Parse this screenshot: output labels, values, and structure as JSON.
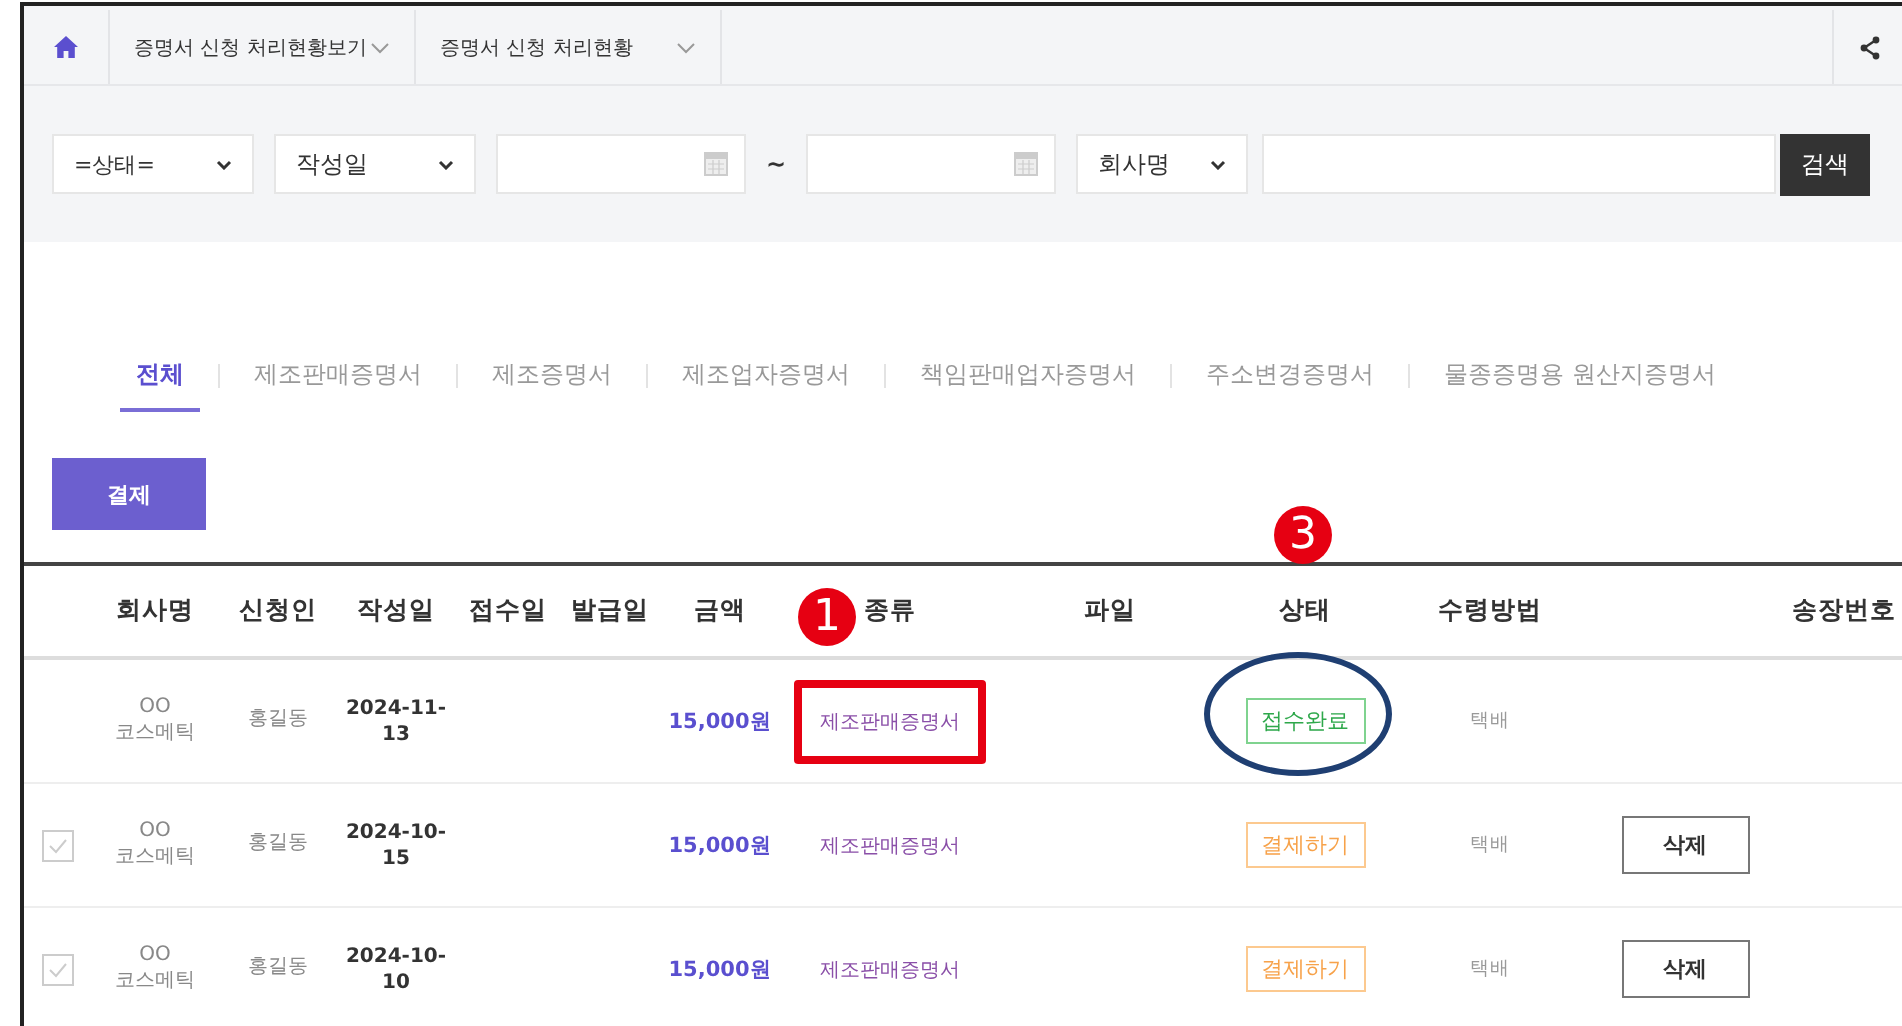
{
  "breadcrumbs": [
    {
      "label": "증명서 신청 처리현황보기"
    },
    {
      "label": "증명서 신청 처리현황"
    }
  ],
  "filters": {
    "status_select": "=상태=",
    "date_select": "작성일",
    "range_sep": "~",
    "field_select": "회사명",
    "search_button": "검색"
  },
  "tabs": [
    {
      "label": "전체",
      "selected": true
    },
    {
      "label": "제조판매증명서",
      "selected": false
    },
    {
      "label": "제조증명서",
      "selected": false
    },
    {
      "label": "제조업자증명서",
      "selected": false
    },
    {
      "label": "책임판매업자증명서",
      "selected": false
    },
    {
      "label": "주소변경증명서",
      "selected": false
    },
    {
      "label": "물종증명용 원산지증명서",
      "selected": false
    }
  ],
  "pay_button": "결제",
  "table": {
    "columns": [
      {},
      {
        "label": "회사명"
      },
      {
        "label": "신청인"
      },
      {
        "label": "작성일"
      },
      {
        "label": "접수일"
      },
      {
        "label": "발급일"
      },
      {
        "label": "금액"
      },
      {
        "label": "종류",
        "marker": "1"
      },
      {
        "label": "파일"
      },
      {
        "label": "상태",
        "marker": "3"
      },
      {
        "label": "수령방법"
      },
      {},
      {
        "label": "송장번호"
      }
    ],
    "rows": [
      {
        "company": [
          "OO",
          "코스메틱"
        ],
        "applicant": "홍길동",
        "written": [
          "2024-11-",
          "13"
        ],
        "amount": "15,000원",
        "type": "제조판매증명서",
        "type_boxed": true,
        "status": {
          "kind": "done",
          "label": "접수완료"
        },
        "status_circled": true,
        "delivery": "택배"
      },
      {
        "checked": false,
        "company": [
          "OO",
          "코스메틱"
        ],
        "applicant": "홍길동",
        "written": [
          "2024-10-",
          "15"
        ],
        "amount": "15,000원",
        "type": "제조판매증명서",
        "type_boxed": false,
        "status": {
          "kind": "pay",
          "label": "결제하기"
        },
        "status_circled": false,
        "delivery": "택배",
        "delete": "삭제"
      },
      {
        "checked": false,
        "company": [
          "OO",
          "코스메틱"
        ],
        "applicant": "홍길동",
        "written": [
          "2024-10-",
          "10"
        ],
        "amount": "15,000원",
        "type": "제조판매증명서",
        "type_boxed": false,
        "status": {
          "kind": "pay",
          "label": "결제하기"
        },
        "status_circled": false,
        "delivery": "택배",
        "delete": "삭제"
      }
    ]
  }
}
